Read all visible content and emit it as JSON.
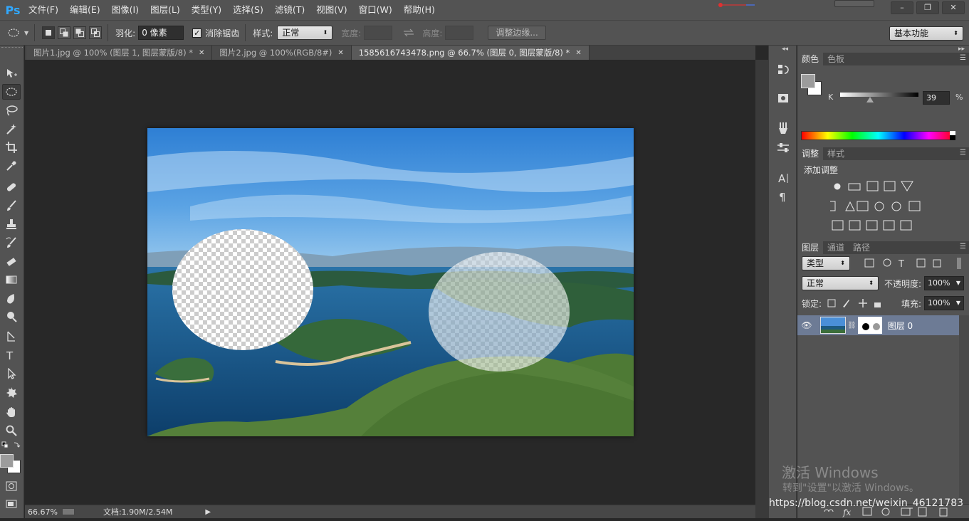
{
  "app": {
    "logo": "Ps"
  },
  "menu": [
    "文件(F)",
    "编辑(E)",
    "图像(I)",
    "图层(L)",
    "类型(Y)",
    "选择(S)",
    "滤镜(T)",
    "视图(V)",
    "窗口(W)",
    "帮助(H)"
  ],
  "window_controls": {
    "minimize": "–",
    "restore": "❐",
    "close": "✕"
  },
  "options": {
    "feather_label": "羽化:",
    "feather_value": "0 像素",
    "antialias_label": "消除锯齿",
    "antialias_checked": true,
    "style_label": "样式:",
    "style_value": "正常",
    "width_label": "宽度:",
    "width_value": "",
    "height_label": "高度:",
    "height_value": "",
    "refine_edge": "调整边缘...",
    "workspace": "基本功能"
  },
  "tabs": [
    {
      "label": "图片1.jpg @ 100% (图层 1, 图层蒙版/8) *",
      "active": false
    },
    {
      "label": "图片2.jpg @ 100%(RGB/8#)",
      "active": false
    },
    {
      "label": "1585616743478.png @ 66.7% (图层 0, 图层蒙版/8) *",
      "active": true
    }
  ],
  "status": {
    "zoom": "66.67%",
    "doc": "文档:1.90M/2.54M"
  },
  "color_panel": {
    "tabs": [
      "颜色",
      "色板"
    ],
    "channel": "K",
    "value": "39",
    "unit": "%",
    "foreground": "#9c9c9c",
    "background": "#ffffff"
  },
  "adjust_panel": {
    "tabs": [
      "调整",
      "样式"
    ],
    "title": "添加调整"
  },
  "layers_panel": {
    "tabs": [
      "图层",
      "通道",
      "路径"
    ],
    "filter": "类型",
    "blend_mode": "正常",
    "opacity_label": "不透明度:",
    "opacity_value": "100%",
    "lock_label": "锁定:",
    "fill_label": "填充:",
    "fill_value": "100%",
    "layer_name": "图层 0"
  },
  "watermark": {
    "line1": "激活 Windows",
    "line2": "转到\"设置\"以激活 Windows。",
    "url": "https://blog.csdn.net/weixin_46121783"
  }
}
